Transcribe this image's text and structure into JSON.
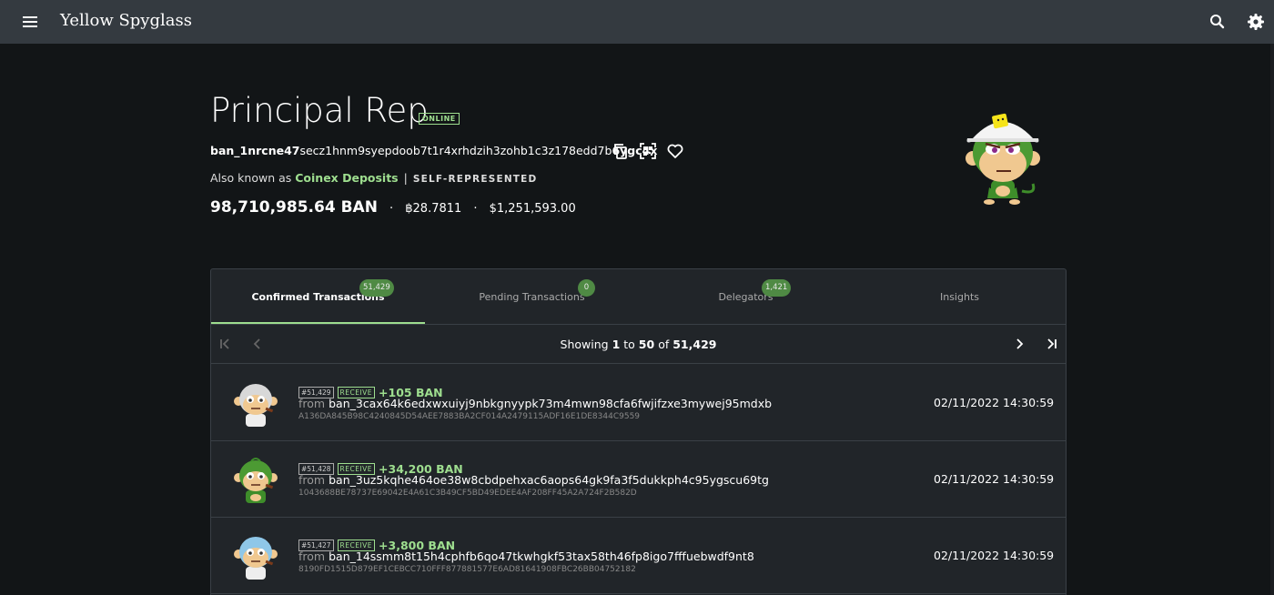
{
  "app": {
    "title": "Yellow Spyglass"
  },
  "topbar": {
    "menu_icon": "hamburger-icon",
    "search_icon": "search-icon",
    "settings_icon": "gear-icon"
  },
  "account": {
    "name": "Principal Rep",
    "status": "ONLINE",
    "address_prefix": "ban_1nrcne47",
    "address_middle": "secz1hnm9syepdoob7t1r4xrhdzih3zohb1c3z178edd7b",
    "address_suffix": "6ygc4x",
    "aka_label": "Also known as",
    "alias": "Coinex Deposits",
    "separator": "|",
    "self_rep": "SELF-REPRESENTED",
    "balance": "98,710,985.64 BAN",
    "btc_value": "฿28.7811",
    "usd_value": "$1,251,593.00",
    "accent": "#9ede8f"
  },
  "tabs": [
    {
      "label": "Confirmed Transactions",
      "badge": "51,429",
      "active": true
    },
    {
      "label": "Pending Transactions",
      "badge": "0",
      "active": false
    },
    {
      "label": "Delegators",
      "badge": "1,421",
      "active": false
    },
    {
      "label": "Insights",
      "badge": "",
      "active": false
    }
  ],
  "pager": {
    "showing": "Showing",
    "from": "1",
    "to_label": "to",
    "to": "50",
    "of_label": "of",
    "total": "51,429"
  },
  "transactions": [
    {
      "height": "#51,429",
      "type": "RECEIVE",
      "amount": "+105 BAN",
      "from_label": "from",
      "from": "ban_3cax64k6edxwxuiyj9nbkgnyypk73m4mwn98cfa6fwjifzxe3mywej95mdxb",
      "hash": "A136DA845B98C4240845D54AEE7883BA2CF014A2479115ADF16E1DE8344C9559",
      "date": "02/11/2022",
      "time": "14:30:59"
    },
    {
      "height": "#51,428",
      "type": "RECEIVE",
      "amount": "+34,200 BAN",
      "from_label": "from",
      "from": "ban_3uz5kqhe464oe38w8cbdpehxac6aops64gk9fa3f5dukkph4c95ygscu69tg",
      "hash": "1043688BE78737E69042E4A61C3B49CF5BD49EDEE4AF208FF45A2A724F2B582D",
      "date": "02/11/2022",
      "time": "14:30:59"
    },
    {
      "height": "#51,427",
      "type": "RECEIVE",
      "amount": "+3,800 BAN",
      "from_label": "from",
      "from": "ban_14ssmm8t15h4cphfb6qo47tkwhgkf53tax58th46fp8igo7fffuebwdf9nt8",
      "hash": "8190FD1515D879EF1CEBCC710FFF877881577E6AD81641908FBC26BB04752182",
      "date": "02/11/2022",
      "time": "14:30:59"
    }
  ]
}
